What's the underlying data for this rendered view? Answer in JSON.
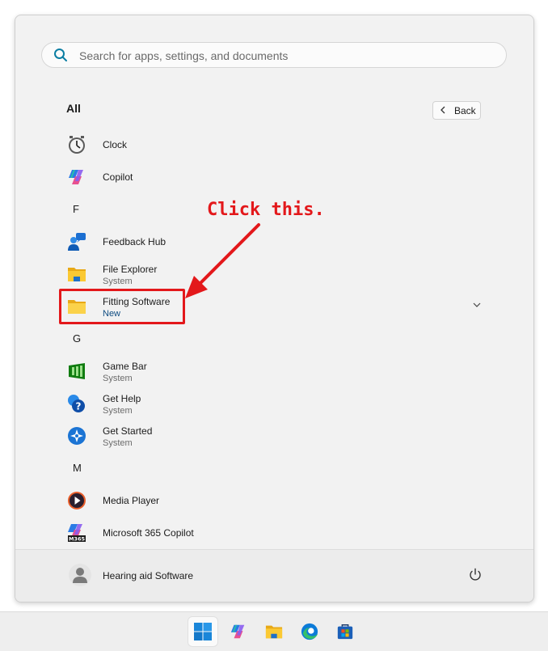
{
  "search": {
    "placeholder": "Search for apps, settings, and documents"
  },
  "header": {
    "all_label": "All",
    "back_label": "Back"
  },
  "apps": {
    "clock": {
      "name": "Clock"
    },
    "copilot": {
      "name": "Copilot"
    },
    "letter_f": "F",
    "feedback_hub": {
      "name": "Feedback Hub"
    },
    "file_explorer": {
      "name": "File Explorer",
      "sub": "System"
    },
    "fitting_software": {
      "name": "Fitting Software",
      "sub": "New"
    },
    "letter_g": "G",
    "game_bar": {
      "name": "Game Bar",
      "sub": "System"
    },
    "get_help": {
      "name": "Get Help",
      "sub": "System"
    },
    "get_started": {
      "name": "Get Started",
      "sub": "System"
    },
    "letter_m": "M",
    "media_player": {
      "name": "Media Player"
    },
    "m365_copilot": {
      "name": "Microsoft 365 Copilot",
      "icon_text": "M365"
    }
  },
  "footer": {
    "user_name": "Hearing aid Software"
  },
  "annotation": {
    "text": "Click this.",
    "color": "#e3181b"
  },
  "taskbar": {
    "items": [
      "start-icon",
      "copilot-icon",
      "file-explorer-icon",
      "edge-icon",
      "store-icon"
    ]
  },
  "colors": {
    "accent": "#0067c0",
    "annotation_red": "#e3181b"
  }
}
